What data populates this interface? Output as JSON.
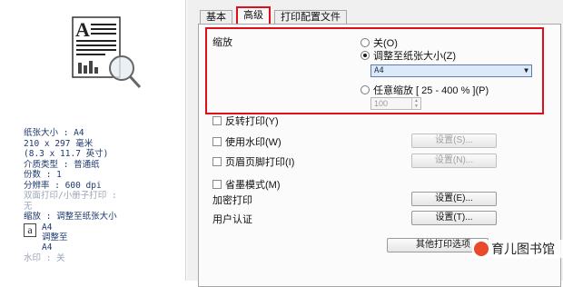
{
  "summary": {
    "paper_size": "纸张大小 : A4",
    "paper_dim_mm": "210 x 297 毫米",
    "paper_dim_in": "(8.3 x 11.7 英寸)",
    "media_type": "介质类型 : 普通纸",
    "copies": "份数 : 1",
    "resolution": "分辨率 : 600 dpi",
    "duplex": "双面打印/小册子打印 :",
    "duplex_value": "无",
    "scaling": "缩放 : 调整至纸张大小",
    "mini_icon_letter": "a",
    "mini_a4_top": "A4",
    "mini_adjust": "调整至",
    "mini_a4_bottom": "A4",
    "watermark": "水印 : 关"
  },
  "tabs": [
    {
      "label": "基本"
    },
    {
      "label": "高级"
    },
    {
      "label": "打印配置文件"
    }
  ],
  "scaling": {
    "label": "缩放",
    "option_off": "关(O)",
    "option_fit": "调整至纸张大小(Z)",
    "fit_selected": "A4",
    "option_free": "任意缩放 [ 25 - 400 % ](P)",
    "free_value": "100"
  },
  "options": {
    "mirror": "反转打印(Y)",
    "watermark": "使用水印(W)",
    "header_footer": "页眉页脚打印(I)",
    "toner_save": "省墨模式(M)",
    "secure_print": "加密打印",
    "user_auth": "用户认证",
    "settings_s": "设置(S)...",
    "settings_n": "设置(N)...",
    "settings_e": "设置(E)...",
    "settings_t": "设置(T)...",
    "other_options": "其他打印选项"
  },
  "site_watermark": "育儿图书馆",
  "colors": {
    "highlight_border": "#e0101a",
    "select_bg": "#dce9f9"
  }
}
